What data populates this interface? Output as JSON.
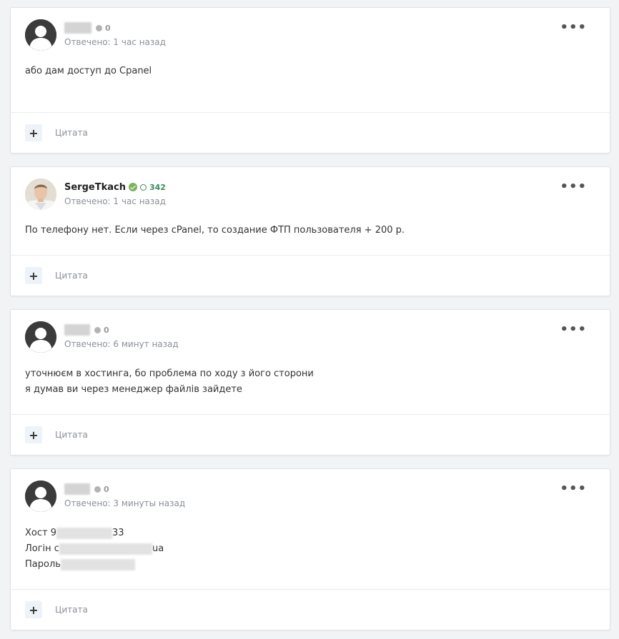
{
  "posts": [
    {
      "author": "",
      "reputation": "0",
      "meta": "Отвечено: 1 час назад",
      "lines": [
        "або дам доступ до Cpanel"
      ],
      "quote": "Цитата"
    },
    {
      "author": "SergeTkach",
      "reputation": "342",
      "meta": "Отвечено: 1 час назад",
      "lines": [
        "По телефону нет. Если через cPanel, то создание ФТП пользователя + 200 р."
      ],
      "quote": "Цитата"
    },
    {
      "author": "",
      "reputation": "0",
      "meta": "Отвечено: 6 минут назад",
      "lines": [
        "уточнюєм в хостинга, бо проблема по ходу з його сторони",
        "я думав ви через менеджер файлів зайдете"
      ],
      "quote": "Цитата"
    },
    {
      "author": "",
      "reputation": "0",
      "meta": "Отвечено: 3 минуты назад",
      "lines": [
        "Хост 9",
        "33",
        "Логін c",
        "ua",
        "Пароль"
      ],
      "quote": "Цитата"
    }
  ],
  "colors": {
    "accent_green": "#3d8b5c",
    "verified": "#7ab35c"
  }
}
